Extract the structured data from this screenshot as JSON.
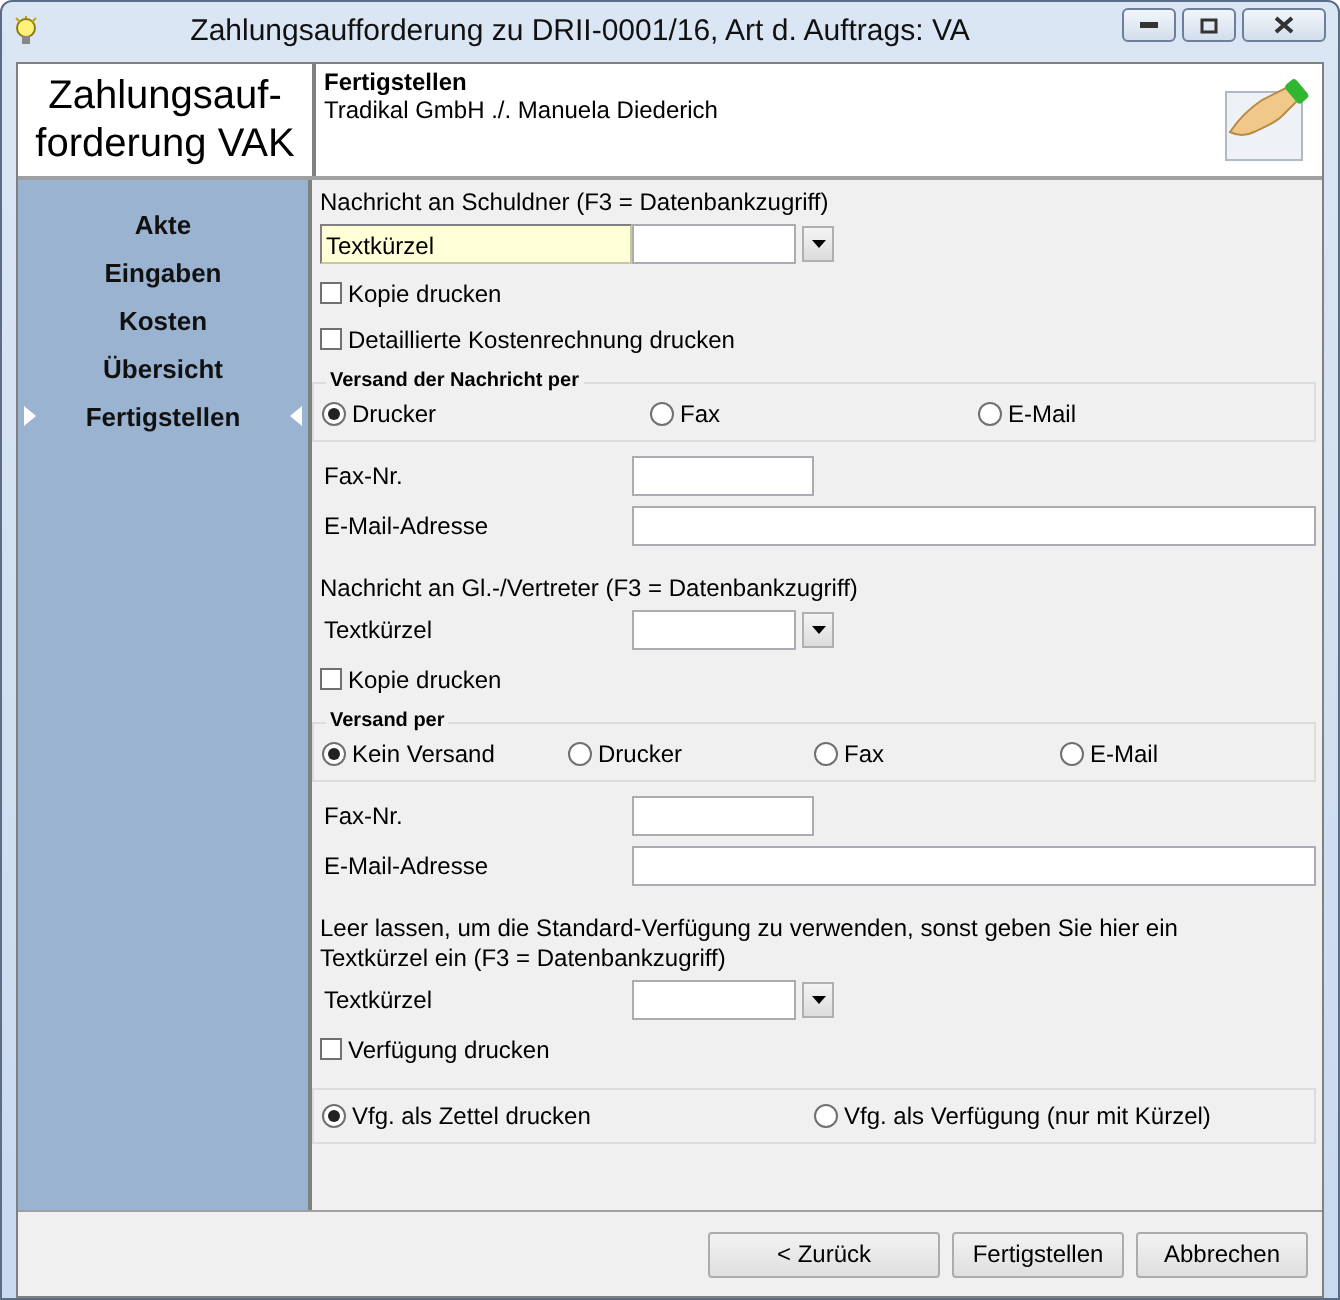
{
  "window": {
    "title": "Zahlungsaufforderung zu DRII-0001/16, Art d. Auftrags: VA"
  },
  "header": {
    "title_lines": [
      "Zahlungsauf-",
      "forderung VAK"
    ],
    "step": "Fertigstellen",
    "subtitle": "Tradikal GmbH ./. Manuela Diederich"
  },
  "sidebar": {
    "items": [
      {
        "label": "Akte",
        "selected": false
      },
      {
        "label": "Eingaben",
        "selected": false
      },
      {
        "label": "Kosten",
        "selected": false
      },
      {
        "label": "Übersicht",
        "selected": false
      },
      {
        "label": "Fertigstellen",
        "selected": true
      }
    ]
  },
  "sections": [
    {
      "heading": "Nachricht an Schuldner (F3 = Datenbankzugriff)",
      "textkuerzel": {
        "label": "Textkürzel",
        "focused": true
      },
      "checkboxes": [
        {
          "label": "Kopie drucken",
          "checked": false
        },
        {
          "label": "Detaillierte Kostenrechnung drucken",
          "checked": false
        }
      ],
      "group": {
        "title": "Versand der Nachricht per",
        "options": [
          {
            "label": "Drucker",
            "selected": true
          },
          {
            "label": "Fax",
            "selected": false
          },
          {
            "label": "E-Mail",
            "selected": false
          }
        ]
      },
      "fields": [
        {
          "label": "Fax-Nr.",
          "kind": "short"
        },
        {
          "label": "E-Mail-Adresse",
          "kind": "long"
        }
      ]
    },
    {
      "heading": "Nachricht an Gl.-/Vertreter (F3 = Datenbankzugriff)",
      "textkuerzel": {
        "label": "Textkürzel",
        "focused": false
      },
      "checkboxes": [
        {
          "label": "Kopie drucken",
          "checked": false
        }
      ],
      "group": {
        "title": "Versand per",
        "options": [
          {
            "label": "Kein Versand",
            "selected": true
          },
          {
            "label": "Drucker",
            "selected": false
          },
          {
            "label": "Fax",
            "selected": false
          },
          {
            "label": "E-Mail",
            "selected": false
          }
        ]
      },
      "fields": [
        {
          "label": "Fax-Nr.",
          "kind": "short"
        },
        {
          "label": "E-Mail-Adresse",
          "kind": "long"
        }
      ]
    },
    {
      "heading": "Leer lassen, um die Standard-Verfügung zu verwenden, sonst geben Sie hier ein Textkürzel ein (F3 = Datenbankzugriff)",
      "textkuerzel": {
        "label": "Textkürzel",
        "focused": false
      },
      "checkboxes": [
        {
          "label": "Verfügung drucken",
          "checked": false
        }
      ],
      "group": {
        "options": [
          {
            "label": "Vfg. als Zettel drucken",
            "selected": true
          },
          {
            "label": "Vfg. als Verfügung (nur mit Kürzel)",
            "selected": false
          }
        ]
      }
    }
  ],
  "buttons": [
    "< Zurück",
    "Fertigstellen",
    "Abbrechen"
  ]
}
